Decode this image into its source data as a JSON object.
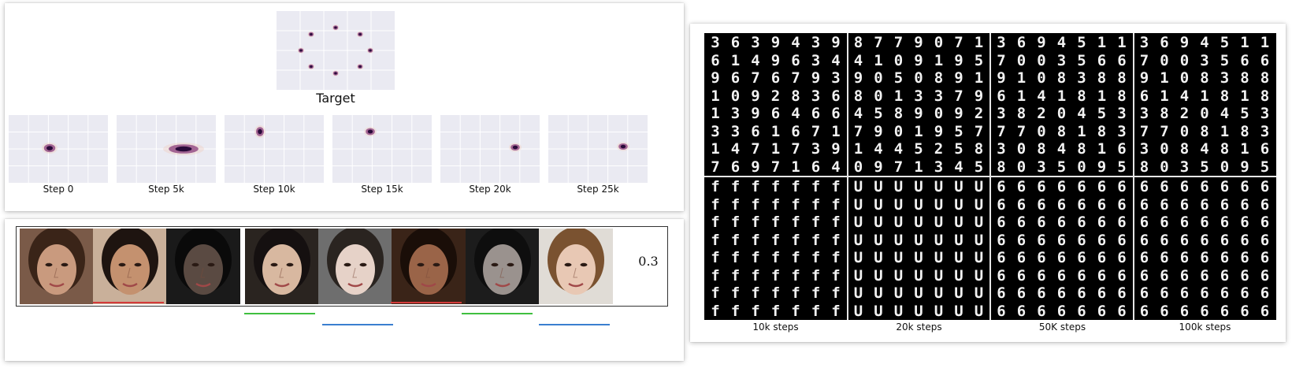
{
  "gaussian_figure": {
    "target_label": "Target",
    "step_labels": [
      "Step 0",
      "Step 5k",
      "Step 10k",
      "Step 15k",
      "Step 20k",
      "Step 25k"
    ]
  },
  "faces_figure": {
    "value": "0.3",
    "line_colors": [
      "#d33b3b",
      "#3fbf3f",
      "#3a7fd0"
    ]
  },
  "mnist_figure": {
    "column_labels": [
      "10k steps",
      "20k steps",
      "50K steps",
      "100k steps"
    ],
    "top_rows": [
      [
        [
          "3",
          "6",
          "3",
          "9",
          "4",
          "3",
          "9"
        ],
        [
          "6",
          "1",
          "4",
          "9",
          "6",
          "3",
          "4"
        ],
        [
          "9",
          "6",
          "7",
          "6",
          "7",
          "9",
          "3"
        ],
        [
          "1",
          "0",
          "9",
          "2",
          "8",
          "3",
          "6"
        ],
        [
          "1",
          "3",
          "9",
          "6",
          "4",
          "6",
          "6"
        ],
        [
          "3",
          "3",
          "6",
          "1",
          "6",
          "7",
          "1"
        ],
        [
          "1",
          "4",
          "7",
          "1",
          "7",
          "3",
          "9"
        ],
        [
          "7",
          "6",
          "9",
          "7",
          "1",
          "6",
          "4"
        ]
      ],
      [
        [
          "8",
          "7",
          "7",
          "9",
          "0",
          "7",
          "1"
        ],
        [
          "4",
          "1",
          "0",
          "9",
          "1",
          "9",
          "5"
        ],
        [
          "9",
          "0",
          "5",
          "0",
          "8",
          "9",
          "1"
        ],
        [
          "8",
          "0",
          "1",
          "3",
          "3",
          "7",
          "9"
        ],
        [
          "4",
          "5",
          "8",
          "9",
          "0",
          "9",
          "2"
        ],
        [
          "7",
          "9",
          "0",
          "1",
          "9",
          "5",
          "7"
        ],
        [
          "1",
          "4",
          "4",
          "5",
          "2",
          "5",
          "8"
        ],
        [
          "0",
          "9",
          "7",
          "1",
          "3",
          "4",
          "5"
        ]
      ],
      [
        [
          "3",
          "6",
          "9",
          "4",
          "5",
          "1",
          "1"
        ],
        [
          "7",
          "0",
          "0",
          "3",
          "5",
          "6",
          "6"
        ],
        [
          "9",
          "1",
          "0",
          "8",
          "3",
          "8",
          "8"
        ],
        [
          "6",
          "1",
          "4",
          "1",
          "8",
          "1",
          "8"
        ],
        [
          "3",
          "8",
          "2",
          "0",
          "4",
          "5",
          "3"
        ],
        [
          "7",
          "7",
          "0",
          "8",
          "1",
          "8",
          "3"
        ],
        [
          "3",
          "0",
          "8",
          "4",
          "8",
          "1",
          "6"
        ],
        [
          "8",
          "0",
          "3",
          "5",
          "0",
          "9",
          "5"
        ]
      ],
      [
        [
          "3",
          "6",
          "9",
          "4",
          "5",
          "1",
          "1"
        ],
        [
          "7",
          "0",
          "0",
          "3",
          "5",
          "6",
          "6"
        ],
        [
          "9",
          "1",
          "0",
          "8",
          "3",
          "8",
          "8"
        ],
        [
          "6",
          "1",
          "4",
          "1",
          "8",
          "1",
          "8"
        ],
        [
          "3",
          "8",
          "2",
          "0",
          "4",
          "5",
          "3"
        ],
        [
          "7",
          "7",
          "0",
          "8",
          "1",
          "8",
          "3"
        ],
        [
          "3",
          "0",
          "8",
          "4",
          "8",
          "1",
          "6"
        ],
        [
          "8",
          "0",
          "3",
          "5",
          "0",
          "9",
          "5"
        ]
      ]
    ],
    "bottom_digits": [
      "f",
      "U",
      "6",
      "6"
    ]
  },
  "colors": {
    "plot_bg": "#eaeaf2",
    "blob_dark": "#2a0a3a",
    "blob_mid": "#8a3b7a",
    "blob_light": "#f0c8b8"
  }
}
